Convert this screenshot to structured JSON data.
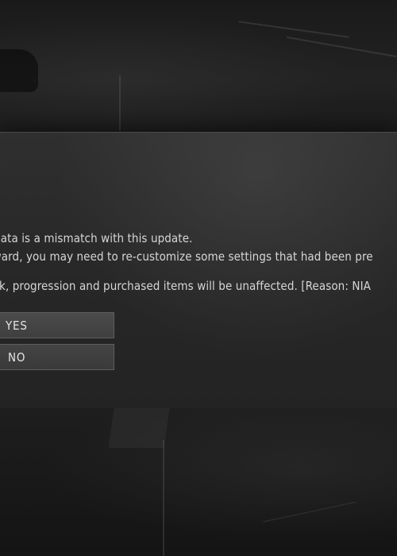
{
  "dialog": {
    "message_lines": [
      "r data is a mismatch with this update.",
      "rward, you may need to re-customize some settings that had been pre",
      "ank, progression and purchased items will be unaffected. [Reason: NIA"
    ],
    "buttons": {
      "yes_label": "YES",
      "no_label": "NO"
    }
  }
}
